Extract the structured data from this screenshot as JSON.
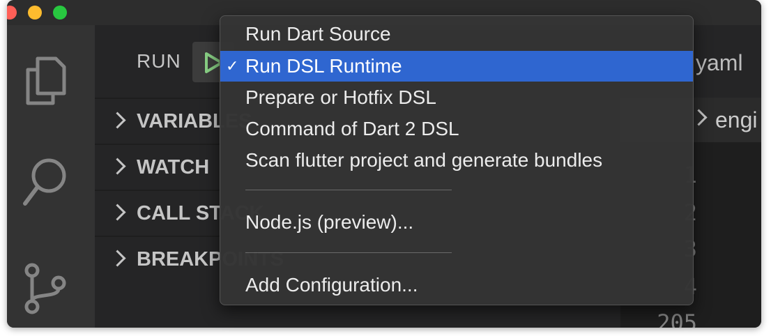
{
  "run_panel": {
    "label": "RUN"
  },
  "sections": [
    {
      "title": "VARIABLES"
    },
    {
      "title": "WATCH"
    },
    {
      "title": "CALL STACK"
    },
    {
      "title": "BREAKPOINTS"
    }
  ],
  "editor": {
    "tab_title": "yaml",
    "breadcrumb": "engi",
    "line_numbers": [
      "1",
      "2",
      "3",
      "4",
      "205"
    ]
  },
  "menu": {
    "group1": [
      {
        "label": "Run Dart Source",
        "selected": false
      },
      {
        "label": "Run DSL Runtime",
        "selected": true,
        "check": "✓"
      },
      {
        "label": "Prepare or Hotfix DSL",
        "selected": false
      },
      {
        "label": "Command of Dart 2 DSL",
        "selected": false
      },
      {
        "label": "Scan flutter project and generate bundles",
        "selected": false
      }
    ],
    "node": {
      "label": "Node.js (preview)..."
    },
    "add": {
      "label": "Add Configuration..."
    }
  },
  "colors": {
    "highlight": "#2f66d0",
    "run_icon": "#89d185",
    "activity_icon": "#858585"
  }
}
